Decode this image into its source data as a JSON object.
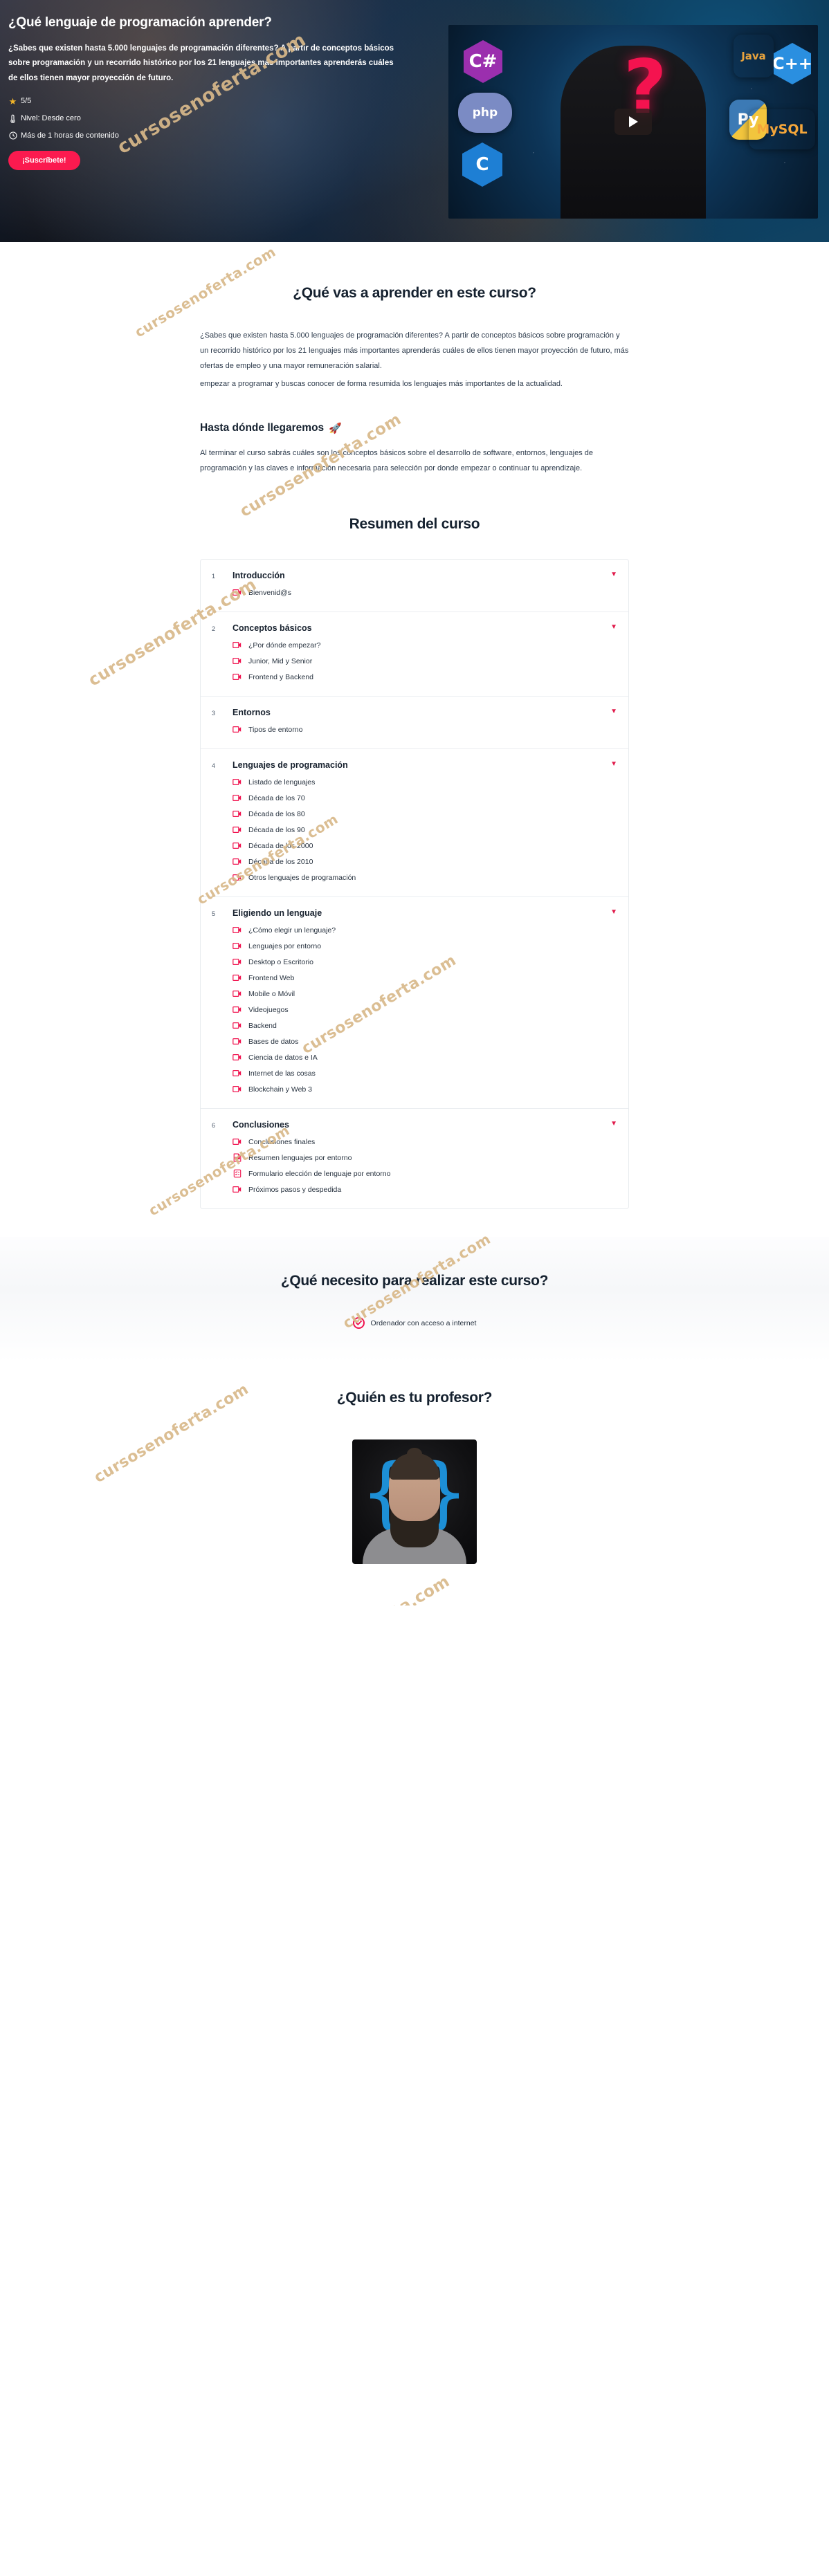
{
  "hero": {
    "title": "¿Qué lenguaje de programación aprender?",
    "description": "¿Sabes que existen hasta 5.000 lenguajes de programación diferentes? A partir de conceptos básicos sobre programación y un recorrido histórico por los 21 lenguajes más importantes aprenderás cuáles de ellos tienen mayor proyección de futuro.",
    "rating": "5/5",
    "level": "Nivel: Desde cero",
    "duration": "Más de 1 horas de contenido",
    "cta_label": "¡Suscríbete!",
    "video_badges": [
      "C#",
      "php",
      "C",
      "Java",
      "C++",
      "Py",
      "MySQL"
    ],
    "play_label": "play-button"
  },
  "learn": {
    "title": "¿Qué vas a aprender en este curso?",
    "paragraph_1": "¿Sabes que existen hasta 5.000 lenguajes de programación diferentes? A partir de conceptos básicos sobre programación y un recorrido histórico por los 21 lenguajes más importantes aprenderás cuáles de ellos tienen mayor proyección de futuro, más ofertas de empleo y una mayor remuneración salarial.",
    "paragraph_2": "empezar a programar y buscas conocer de forma resumida los lenguajes más importantes de la actualidad."
  },
  "goal": {
    "title": "Hasta dónde llegaremos",
    "emoji": "🚀",
    "paragraph": "Al terminar el curso sabrás cuáles son los conceptos básicos sobre el desarrollo de software, entornos, lenguajes de programación y las claves e información necesaria para selección por donde empezar o continuar tu aprendizaje."
  },
  "summary": {
    "title": "Resumen del curso",
    "sections": [
      {
        "number": "1",
        "title": "Introducción",
        "lessons": [
          {
            "label": "Bienvenid@s",
            "icon": "video-icon"
          }
        ]
      },
      {
        "number": "2",
        "title": "Conceptos básicos",
        "lessons": [
          {
            "label": "¿Por dónde empezar?",
            "icon": "video-icon"
          },
          {
            "label": "Junior, Mid y Senior",
            "icon": "video-icon"
          },
          {
            "label": "Frontend y Backend",
            "icon": "video-icon"
          }
        ]
      },
      {
        "number": "3",
        "title": "Entornos",
        "lessons": [
          {
            "label": "Tipos de entorno",
            "icon": "video-icon"
          }
        ]
      },
      {
        "number": "4",
        "title": "Lenguajes de programación",
        "lessons": [
          {
            "label": "Listado de lenguajes",
            "icon": "video-icon"
          },
          {
            "label": "Década de los 70",
            "icon": "video-icon"
          },
          {
            "label": "Década de los 80",
            "icon": "video-icon"
          },
          {
            "label": "Década de los 90",
            "icon": "video-icon"
          },
          {
            "label": "Década de los 2000",
            "icon": "video-icon"
          },
          {
            "label": "Década de los 2010",
            "icon": "video-icon"
          },
          {
            "label": "Otros lenguajes de programación",
            "icon": "video-icon"
          }
        ]
      },
      {
        "number": "5",
        "title": "Eligiendo un lenguaje",
        "lessons": [
          {
            "label": "¿Cómo elegir un lenguaje?",
            "icon": "video-icon"
          },
          {
            "label": "Lenguajes por entorno",
            "icon": "video-icon"
          },
          {
            "label": "Desktop o Escritorio",
            "icon": "video-icon"
          },
          {
            "label": "Frontend Web",
            "icon": "video-icon"
          },
          {
            "label": "Mobile o Móvil",
            "icon": "video-icon"
          },
          {
            "label": "Videojuegos",
            "icon": "video-icon"
          },
          {
            "label": "Backend",
            "icon": "video-icon"
          },
          {
            "label": "Bases de datos",
            "icon": "video-icon"
          },
          {
            "label": "Ciencia de datos e IA",
            "icon": "video-icon"
          },
          {
            "label": "Internet de las cosas",
            "icon": "video-icon"
          },
          {
            "label": "Blockchain y Web 3",
            "icon": "video-icon"
          }
        ]
      },
      {
        "number": "6",
        "title": "Conclusiones",
        "lessons": [
          {
            "label": "Conclusiones finales",
            "icon": "video-icon"
          },
          {
            "label": "Resumen lenguajes por entorno",
            "icon": "pdf-icon"
          },
          {
            "label": "Formulario elección de lenguaje por entorno",
            "icon": "form-icon"
          },
          {
            "label": "Próximos pasos y despedida",
            "icon": "video-icon"
          }
        ]
      }
    ]
  },
  "requirements": {
    "title": "¿Qué necesito para realizar este curso?",
    "items": [
      {
        "label": "Ordenador con acceso a internet",
        "icon": "check-circle-icon"
      }
    ]
  },
  "teacher": {
    "title": "¿Quién es tu profesor?"
  },
  "watermark": {
    "text": "cursosenoferta.com"
  },
  "colors": {
    "accent_pink": "#fb1a4f",
    "accent_red": "#e01c4c",
    "star_yellow": "#f0b429",
    "brace_blue": "#1d8fd6",
    "watermark": "#d9b98a",
    "text_dark": "#15212f"
  }
}
